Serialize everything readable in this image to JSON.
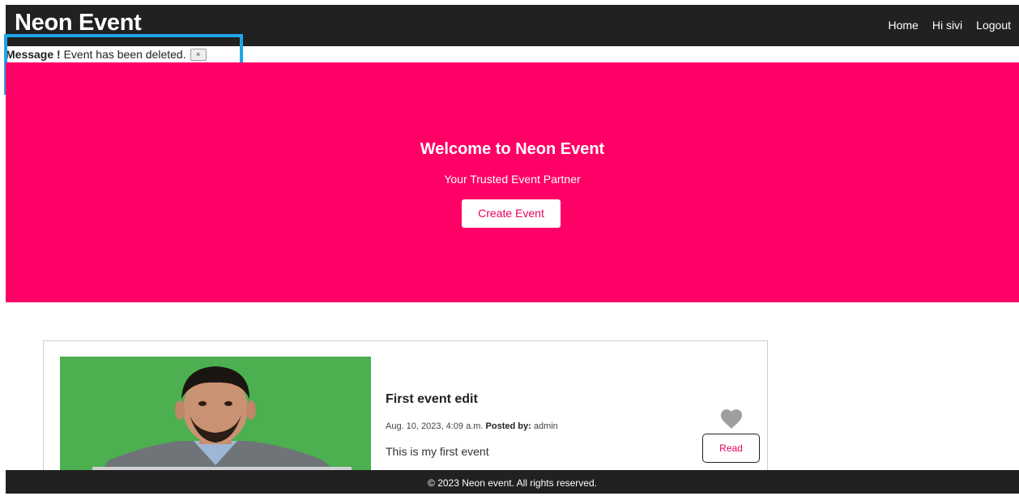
{
  "navbar": {
    "brand": "Neon Event",
    "links": [
      "Home",
      "Hi sivi",
      "Logout"
    ]
  },
  "message": {
    "title": "Message !",
    "text": "Event has been deleted.",
    "close": "×"
  },
  "hero": {
    "title": "Welcome to Neon Event",
    "subtitle": "Your Trusted Event Partner",
    "button": "Create Event"
  },
  "event": {
    "title": "First event edit",
    "date": "Aug. 10, 2023, 4:09 a.m.",
    "posted_by_label": "Posted by:",
    "posted_by": "admin",
    "description": "This is my first event",
    "read_button": "Read",
    "like_icon": "heart-icon"
  },
  "footer": {
    "text": "© 2023 Neon event. All rights reserved."
  },
  "colors": {
    "nav_bg": "#212121",
    "hero_bg": "#ff0066",
    "accent": "#e8005e",
    "highlight": "#1ea5e6",
    "image_bg": "#4caf50"
  }
}
